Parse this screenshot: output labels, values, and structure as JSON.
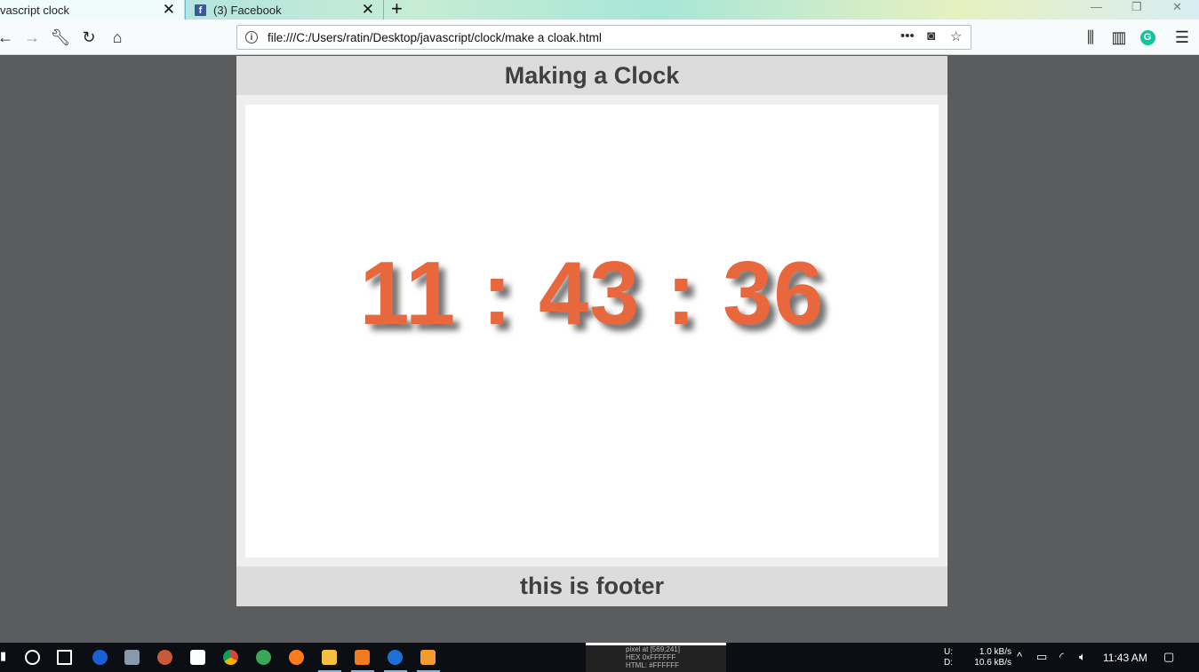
{
  "browser": {
    "tabs": [
      {
        "title": "vascript clock",
        "active": true
      },
      {
        "title": "(3) Facebook",
        "active": false
      }
    ],
    "new_tab_symbol": "+",
    "close_symbol": "✕",
    "url": "file:///C:/Users/ratin/Desktop/javascript/clock/make a cloak.html"
  },
  "page": {
    "header": "Making a Clock",
    "time": "11 : 43 : 36",
    "footer": "this is footer",
    "clock_color": "#e8673c"
  },
  "taskbar": {
    "pixel_info": [
      "pixel at [569;241]",
      "HEX 0xFFFFFF",
      "HTML: #FFFFFF"
    ],
    "upload_label": "U:",
    "download_label": "D:",
    "upload_speed": "1.0 kB/s",
    "download_speed": "10.6 kB/s",
    "time": "11:43 AM"
  }
}
